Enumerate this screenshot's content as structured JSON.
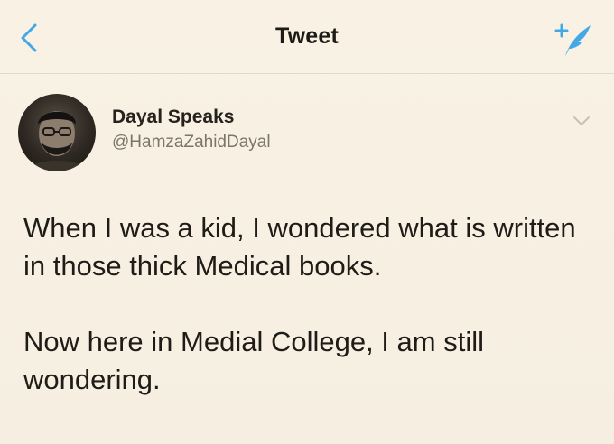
{
  "header": {
    "title": "Tweet",
    "back_icon": "chevron-left-icon",
    "compose_icon": "compose-tweet-icon",
    "accent_color": "#45a8e6"
  },
  "author": {
    "display_name": "Dayal Speaks",
    "handle": "@HamzaZahidDayal"
  },
  "tweet": {
    "paragraphs": [
      "When I was a kid, I wondered what is written in those thick Medical books.",
      "Now here in Medial College, I am still wondering."
    ]
  }
}
